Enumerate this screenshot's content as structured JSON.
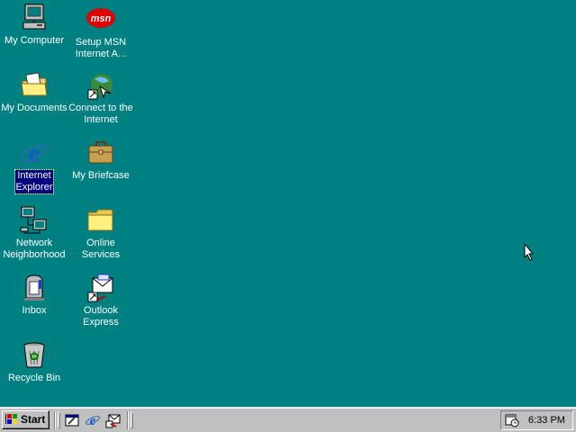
{
  "desktop": {
    "background_color": "#008080",
    "icons": [
      {
        "label": "My Computer",
        "icon": "my-computer-icon"
      },
      {
        "label": "Setup MSN\nInternet A...",
        "icon": "msn-icon"
      },
      {
        "label": "My Documents",
        "icon": "folder-documents-icon"
      },
      {
        "label": "Connect to the\nInternet",
        "icon": "connect-internet-icon"
      },
      {
        "label": "Internet\nExplorer",
        "icon": "internet-explorer-icon",
        "selected": true
      },
      {
        "label": "My Briefcase",
        "icon": "briefcase-icon"
      },
      {
        "label": "Network\nNeighborhood",
        "icon": "network-icon"
      },
      {
        "label": "Online\nServices",
        "icon": "folder-icon"
      },
      {
        "label": "Inbox",
        "icon": "inbox-icon"
      },
      {
        "label": "Outlook\nExpress",
        "icon": "outlook-express-icon"
      },
      {
        "label": "Recycle Bin",
        "icon": "recycle-bin-icon"
      }
    ],
    "msn_logo_text": "msn"
  },
  "taskbar": {
    "start_label": "Start",
    "quick_launch": [
      {
        "icon": "show-desktop-icon"
      },
      {
        "icon": "internet-explorer-icon"
      },
      {
        "icon": "outlook-express-icon"
      }
    ],
    "tray_icon": "scheduler-icon",
    "clock": "6:33 PM"
  }
}
